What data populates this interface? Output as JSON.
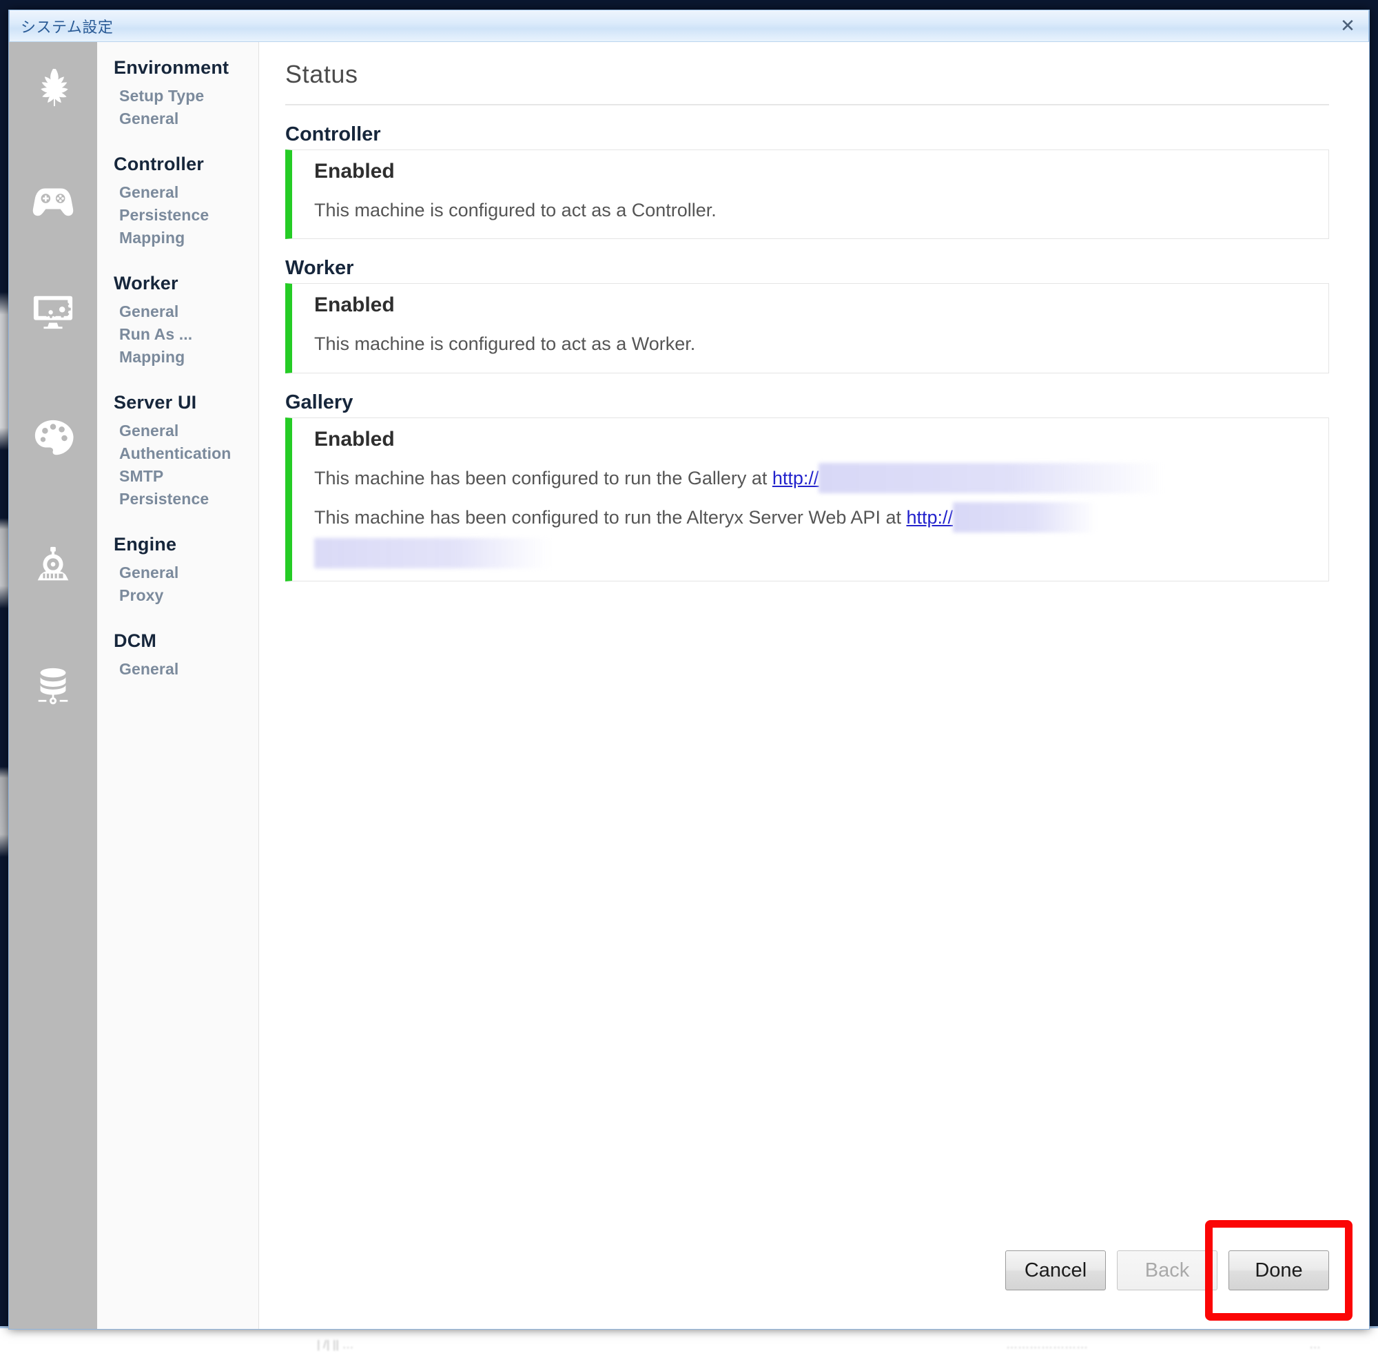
{
  "window": {
    "title": "システム設定",
    "close_icon": "close-icon",
    "close_glyph": "✕"
  },
  "icon_rail": [
    {
      "name": "leaf-icon",
      "label": "Environment"
    },
    {
      "name": "gamepad-icon",
      "label": "Controller"
    },
    {
      "name": "monitor-gears-icon",
      "label": "Worker"
    },
    {
      "name": "palette-icon",
      "label": "Server UI"
    },
    {
      "name": "train-engine-icon",
      "label": "Engine"
    },
    {
      "name": "database-icon",
      "label": "DCM"
    }
  ],
  "sidebar": {
    "groups": [
      {
        "title": "Environment",
        "items": [
          "Setup Type",
          "General"
        ]
      },
      {
        "title": "Controller",
        "items": [
          "General",
          "Persistence",
          "Mapping"
        ]
      },
      {
        "title": "Worker",
        "items": [
          "General",
          "Run As ...",
          "Mapping"
        ]
      },
      {
        "title": "Server UI",
        "items": [
          "General",
          "Authentication",
          "SMTP",
          "Persistence"
        ]
      },
      {
        "title": "Engine",
        "items": [
          "General",
          "Proxy"
        ]
      },
      {
        "title": "DCM",
        "items": [
          "General"
        ]
      }
    ]
  },
  "main": {
    "heading": "Status",
    "accent_color": "#25cc25",
    "link_color": "#2222cc",
    "sections": [
      {
        "title": "Controller",
        "state": "Enabled",
        "lines": [
          {
            "text": "This machine is configured to act as a Controller."
          }
        ]
      },
      {
        "title": "Worker",
        "state": "Enabled",
        "lines": [
          {
            "text": "This machine is configured to act as a Worker."
          }
        ]
      },
      {
        "title": "Gallery",
        "state": "Enabled",
        "lines": [
          {
            "text": "This machine has been configured to run the Gallery at ",
            "link": "http://",
            "redacted": true
          },
          {
            "text": "This machine has been configured to run the Alteryx Server Web API at ",
            "link": "http://",
            "redacted": true,
            "redacted_wrap": true
          }
        ]
      }
    ]
  },
  "footer": {
    "cancel_label": "Cancel",
    "back_label": "Back",
    "done_label": "Done",
    "back_disabled": true,
    "highlight_color": "#fb0505",
    "highlighted_button": "Done"
  }
}
